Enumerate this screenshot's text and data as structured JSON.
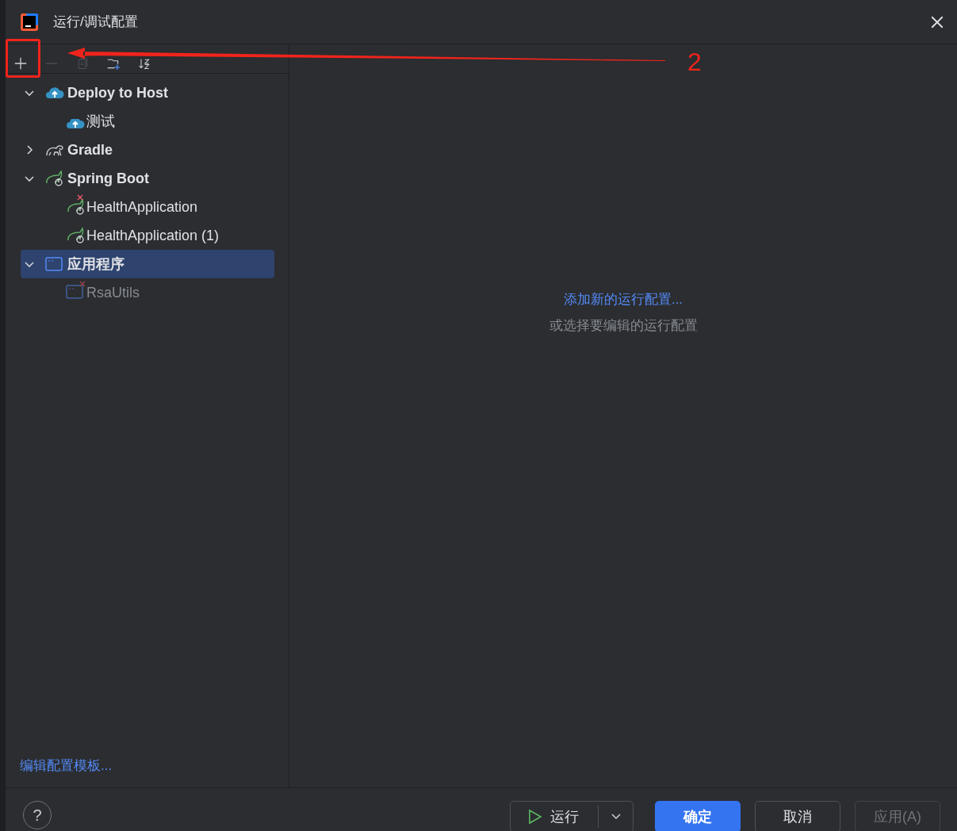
{
  "window": {
    "title": "运行/调试配置"
  },
  "toolbar": [
    {
      "kind": "add",
      "disabled": false
    },
    {
      "kind": "remove",
      "disabled": true
    },
    {
      "kind": "copy",
      "disabled": true
    },
    {
      "kind": "folder",
      "disabled": false
    },
    {
      "kind": "sort",
      "disabled": false
    }
  ],
  "tree": [
    {
      "label": "Deploy to Host",
      "kind": "deploy",
      "expanded": true,
      "selected": false,
      "children": [
        {
          "label": "测试",
          "kind": "deploy",
          "error": false,
          "temporary": false,
          "selected": false
        }
      ]
    },
    {
      "label": "Gradle",
      "kind": "gradle",
      "expanded": false,
      "selected": false
    },
    {
      "label": "Spring Boot",
      "kind": "spring",
      "expanded": true,
      "selected": false,
      "children": [
        {
          "label": "HealthApplication",
          "kind": "spring",
          "error": true,
          "temporary": false,
          "selected": false
        },
        {
          "label": "HealthApplication (1)",
          "kind": "spring",
          "error": false,
          "temporary": false,
          "selected": false
        }
      ]
    },
    {
      "label": "应用程序",
      "kind": "app",
      "expanded": true,
      "selected": true,
      "children": [
        {
          "label": "RsaUtils",
          "kind": "app",
          "error": true,
          "temporary": true,
          "selected": false
        }
      ]
    }
  ],
  "edit_templates_link": "编辑配置模板...",
  "empty_state": {
    "link": "添加新的运行配置...",
    "hint": "或选择要编辑的运行配置"
  },
  "footer": {
    "help_button": "?",
    "run_button": "运行",
    "buttons": [
      {
        "label": "确定",
        "kind": "primary",
        "disabled": false
      },
      {
        "label": "取消",
        "kind": "normal",
        "disabled": false
      },
      {
        "label": "应用(A)",
        "kind": "normal",
        "disabled": true
      }
    ]
  },
  "annotation": {
    "label": "2"
  }
}
